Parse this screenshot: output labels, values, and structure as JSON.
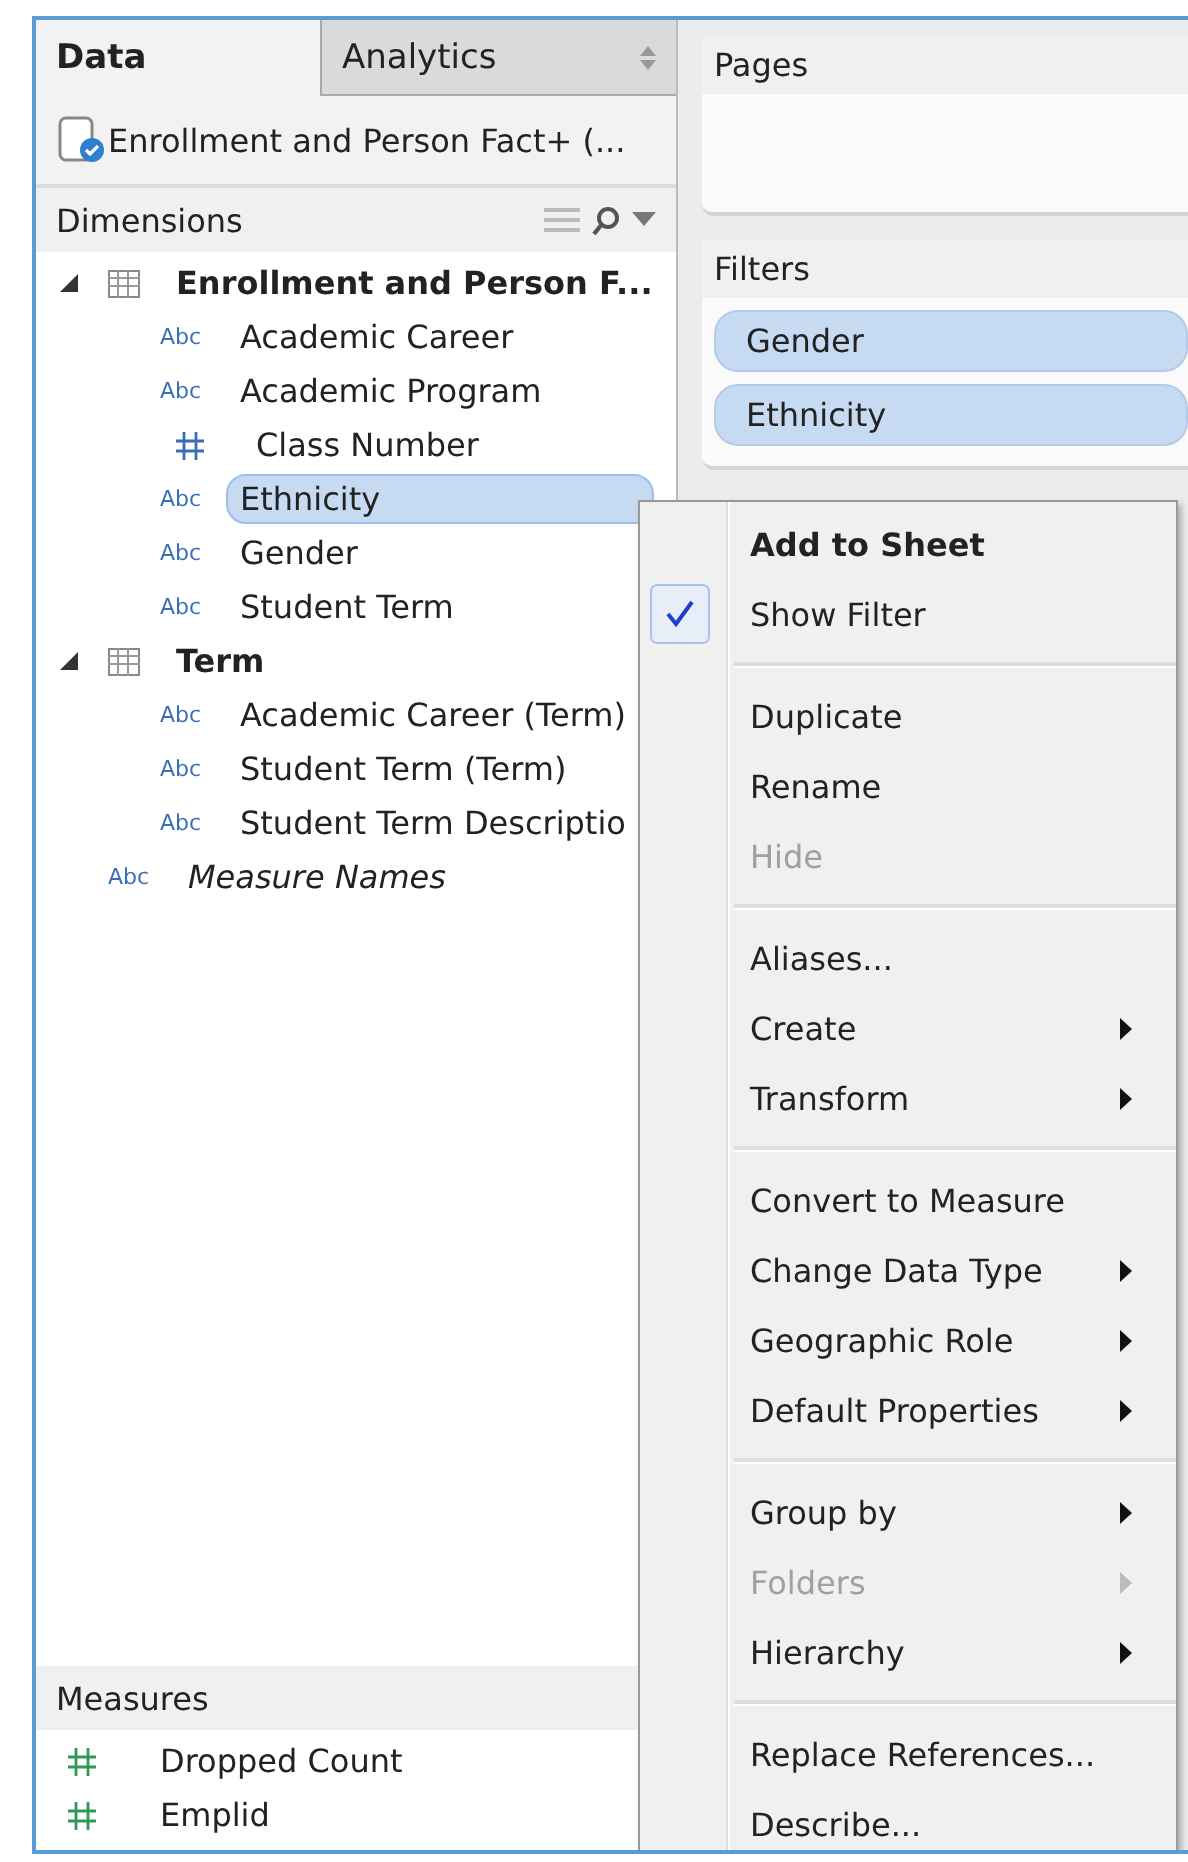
{
  "tabs": [
    {
      "label": "Data",
      "selected": true
    },
    {
      "label": "Analytics",
      "selected": false
    }
  ],
  "data_source": {
    "label": "Enrollment and Person Fact+ (..."
  },
  "dimensions": {
    "title": "Dimensions",
    "tree": [
      {
        "kind": "table",
        "label": "Enrollment and Person F...",
        "expanded": true,
        "children": [
          {
            "kind": "string",
            "type_icon": "Abc",
            "label": "Academic Career",
            "selected": false
          },
          {
            "kind": "string",
            "type_icon": "Abc",
            "label": "Academic Program",
            "selected": false
          },
          {
            "kind": "number",
            "label": "Class Number",
            "selected": false
          },
          {
            "kind": "string",
            "type_icon": "Abc",
            "label": "Ethnicity",
            "selected": true
          },
          {
            "kind": "string",
            "type_icon": "Abc",
            "label": "Gender",
            "selected": false
          },
          {
            "kind": "string",
            "type_icon": "Abc",
            "label": "Student Term",
            "selected": false
          }
        ]
      },
      {
        "kind": "table",
        "label": "Term",
        "expanded": true,
        "children": [
          {
            "kind": "string",
            "type_icon": "Abc",
            "label": "Academic Career (Term)",
            "selected": false
          },
          {
            "kind": "string",
            "type_icon": "Abc",
            "label": "Student Term (Term)",
            "selected": false
          },
          {
            "kind": "string",
            "type_icon": "Abc",
            "label": "Student Term Descriptio",
            "selected": false
          }
        ]
      },
      {
        "kind": "field",
        "type_icon": "Abc",
        "label": "Measure Names"
      }
    ]
  },
  "measures": {
    "title": "Measures",
    "items": [
      {
        "kind": "number",
        "label": "Dropped Count"
      },
      {
        "kind": "number",
        "label": "Emplid"
      }
    ]
  },
  "pages": {
    "title": "Pages"
  },
  "filters": {
    "title": "Filters",
    "pills": [
      "Gender",
      "Ethnicity"
    ]
  },
  "context_menu": [
    {
      "kind": "item",
      "label": "Add to Sheet",
      "bold": true,
      "checked": false,
      "disabled": false,
      "submenu": false
    },
    {
      "kind": "item",
      "label": "Show Filter",
      "bold": false,
      "checked": true,
      "disabled": false,
      "submenu": false
    },
    {
      "kind": "separator"
    },
    {
      "kind": "item",
      "label": "Duplicate",
      "bold": false,
      "checked": false,
      "disabled": false,
      "submenu": false
    },
    {
      "kind": "item",
      "label": "Rename",
      "bold": false,
      "checked": false,
      "disabled": false,
      "submenu": false
    },
    {
      "kind": "item",
      "label": "Hide",
      "bold": false,
      "checked": false,
      "disabled": true,
      "submenu": false
    },
    {
      "kind": "separator"
    },
    {
      "kind": "item",
      "label": "Aliases...",
      "bold": false,
      "checked": false,
      "disabled": false,
      "submenu": false
    },
    {
      "kind": "item",
      "label": "Create",
      "bold": false,
      "checked": false,
      "disabled": false,
      "submenu": true
    },
    {
      "kind": "item",
      "label": "Transform",
      "bold": false,
      "checked": false,
      "disabled": false,
      "submenu": true
    },
    {
      "kind": "separator"
    },
    {
      "kind": "item",
      "label": "Convert to Measure",
      "bold": false,
      "checked": false,
      "disabled": false,
      "submenu": false
    },
    {
      "kind": "item",
      "label": "Change Data Type",
      "bold": false,
      "checked": false,
      "disabled": false,
      "submenu": true
    },
    {
      "kind": "item",
      "label": "Geographic Role",
      "bold": false,
      "checked": false,
      "disabled": false,
      "submenu": true
    },
    {
      "kind": "item",
      "label": "Default Properties",
      "bold": false,
      "checked": false,
      "disabled": false,
      "submenu": true
    },
    {
      "kind": "separator"
    },
    {
      "kind": "item",
      "label": "Group by",
      "bold": false,
      "checked": false,
      "disabled": false,
      "submenu": true
    },
    {
      "kind": "item",
      "label": "Folders",
      "bold": false,
      "checked": false,
      "disabled": true,
      "submenu": true
    },
    {
      "kind": "item",
      "label": "Hierarchy",
      "bold": false,
      "checked": false,
      "disabled": false,
      "submenu": true
    },
    {
      "kind": "separator"
    },
    {
      "kind": "item",
      "label": "Replace References...",
      "bold": false,
      "checked": false,
      "disabled": false,
      "submenu": false
    },
    {
      "kind": "item",
      "label": "Describe...",
      "bold": false,
      "checked": false,
      "disabled": false,
      "submenu": false
    }
  ]
}
